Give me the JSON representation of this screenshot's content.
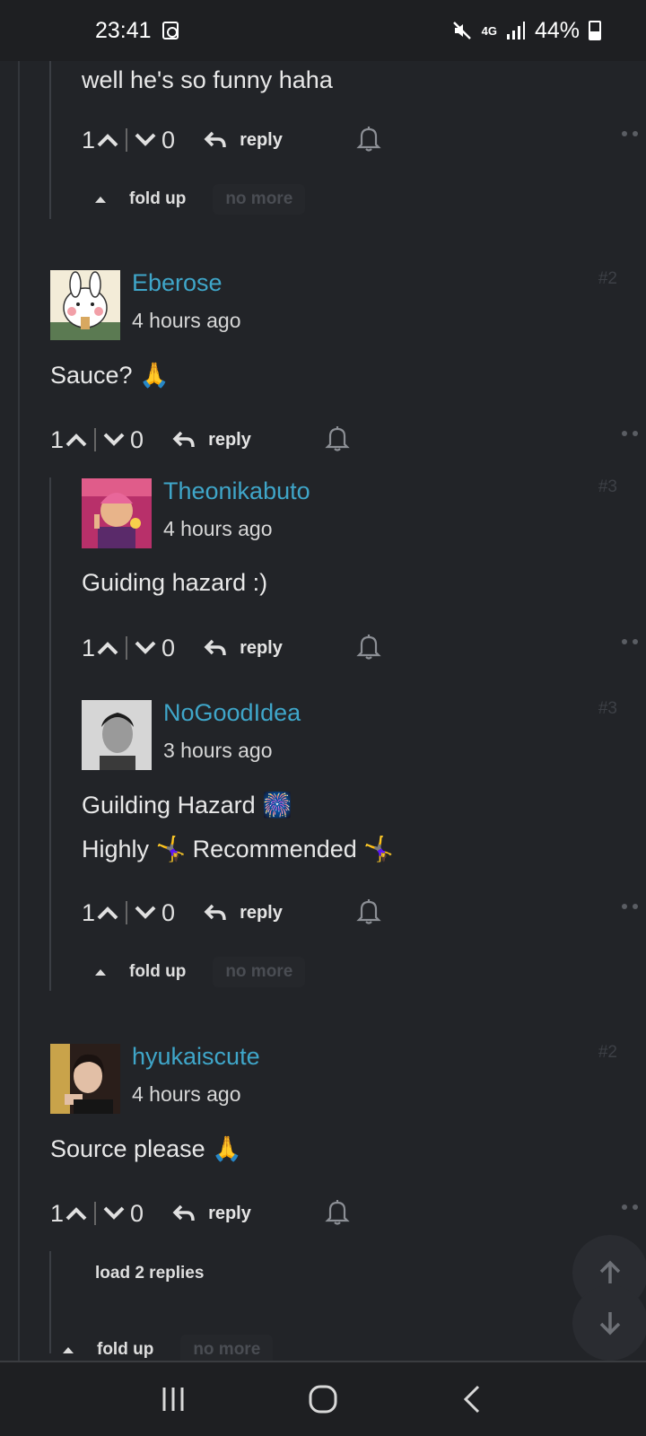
{
  "status_bar": {
    "time": "23:41",
    "network": "4G",
    "battery": "44%",
    "battery_level": 0.44,
    "icons": [
      "alarm-clock-icon",
      "mute-icon",
      "signal-icon",
      "battery-icon"
    ]
  },
  "comments": [
    {
      "text_lines": [
        "well he's so funny haha"
      ],
      "upvotes": "1",
      "downvotes": "0",
      "reply_label": "reply"
    },
    {
      "username": "Eberose",
      "time": "4 hours ago",
      "floor": "#2",
      "text_lines": [
        "Sauce? 🙏"
      ],
      "upvotes": "1",
      "downvotes": "0",
      "reply_label": "reply"
    },
    {
      "username": "Theonikabuto",
      "time": "4 hours ago",
      "floor": "#3",
      "text_lines": [
        "Guiding hazard :)"
      ],
      "upvotes": "1",
      "downvotes": "0",
      "reply_label": "reply"
    },
    {
      "username": "NoGoodIdea",
      "time": "3 hours ago",
      "floor": "#3",
      "text_lines": [
        "Guilding Hazard 🎆",
        "Highly 🤸‍♀️ Recommended 🤸‍♀️"
      ],
      "upvotes": "1",
      "downvotes": "0",
      "reply_label": "reply"
    },
    {
      "username": "hyukaiscute",
      "time": "4 hours ago",
      "floor": "#2",
      "text_lines": [
        "Source please 🙏"
      ],
      "upvotes": "1",
      "downvotes": "0",
      "reply_label": "reply"
    }
  ],
  "thread_controls": {
    "fold_up": "fold up",
    "no_more": "no more",
    "load_replies": "load 2 replies"
  },
  "colors": {
    "background": "#222428",
    "username": "#3fa6c9",
    "text": "#e8e8e8",
    "muted": "#4a4d53"
  }
}
